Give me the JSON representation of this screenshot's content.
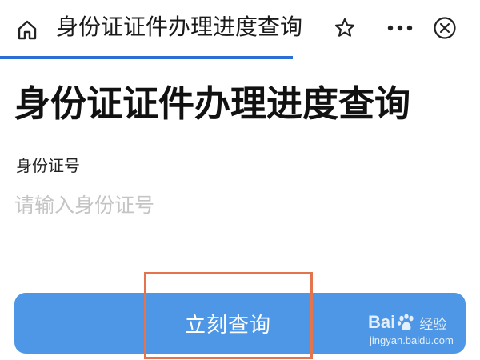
{
  "header": {
    "title": "身份证证件办理进度查询",
    "icons": {
      "home": "home-icon",
      "star": "star-icon",
      "more": "more-icon",
      "close": "close-icon"
    },
    "progress_color": "#2b6fd6"
  },
  "main": {
    "page_title": "身份证证件办理进度查询",
    "id_field": {
      "label": "身份证号",
      "placeholder": "请输入身份证号",
      "value": ""
    },
    "submit_label": "立刻查询"
  },
  "colors": {
    "accent": "#4d97e6",
    "annotation": "#e4744d"
  },
  "watermark": {
    "logo_text": "Baidu经验",
    "url": "jingyan.baidu.com"
  }
}
